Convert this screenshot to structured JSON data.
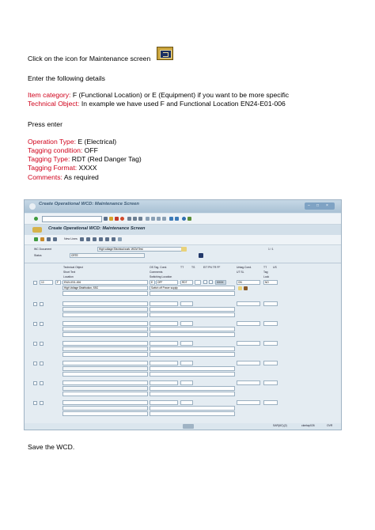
{
  "doc": {
    "line1_text": "Click on the icon for Maintenance screen",
    "icon": "maintenance-screen-icon",
    "line2": "Enter the following details",
    "item_category_label": "Item category:",
    "item_category_value": " F (Functional Location) or E (Equipment) if you want to be more specific",
    "technical_object_label": "Technical Object:",
    "technical_object_value": " In example we have used F and Functional Location EN24-E01-006",
    "press_enter": "Press enter",
    "operation_type_label": "Operation Type:",
    "operation_type_value": " E (Electrical)",
    "tagging_condition_label": "Tagging condition:",
    "tagging_condition_value": " OFF",
    "tagging_type_label": "Tagging Type:",
    "tagging_type_value": " RDT (Red Danger Tag)",
    "tagging_format_label": "Tagging Format:",
    "tagging_format_value": " XXXX",
    "comments_label": "Comments:",
    "comments_value": " As required",
    "save": "Save the WCD.",
    "colors": {
      "red": "#d0021b"
    }
  },
  "sap": {
    "window_title": "Create Operational WCD: Maintenance Screen",
    "screen_title": "Create Operational WCD: Maintenance Screen",
    "new_lines": "New Lines",
    "wc_document_label": "WC Document",
    "wc_document_value": "High voltage Electrical work: WCM Test",
    "status_label": "Status",
    "status_value": "CRTE",
    "page_counter": "1  /    1",
    "col_item": "Technical Object",
    "col_short_text": "Short Text",
    "col_location": "Location",
    "col_op": "OS  Tag. Cond.",
    "col_tt": "TT",
    "col_ts": "TS",
    "col_flags": "EIT  PN  TR  FF",
    "col_comments": "Comments",
    "col_switching": "Switching Location",
    "col_untag": "Untag.Cond.",
    "col_ut": "UT   SL",
    "col_tag": "TT",
    "col_us": "US",
    "col_tag2": "Tag",
    "col_lock": "Lock",
    "row1": {
      "item": "10",
      "cat": "F",
      "tech_obj": "EN24-E01-006",
      "short_text": "High Voltage Distribution, SSC",
      "op": "E",
      "cond": "OFF",
      "tt": "RDT",
      "format": "XXXX",
      "comment": "Switch off Power supply",
      "untag": "ON",
      "tag2": "NO"
    },
    "status_right": "SAR(6C)(2)",
    "status_user": "ckmtap026",
    "status_mode": "OVR"
  }
}
